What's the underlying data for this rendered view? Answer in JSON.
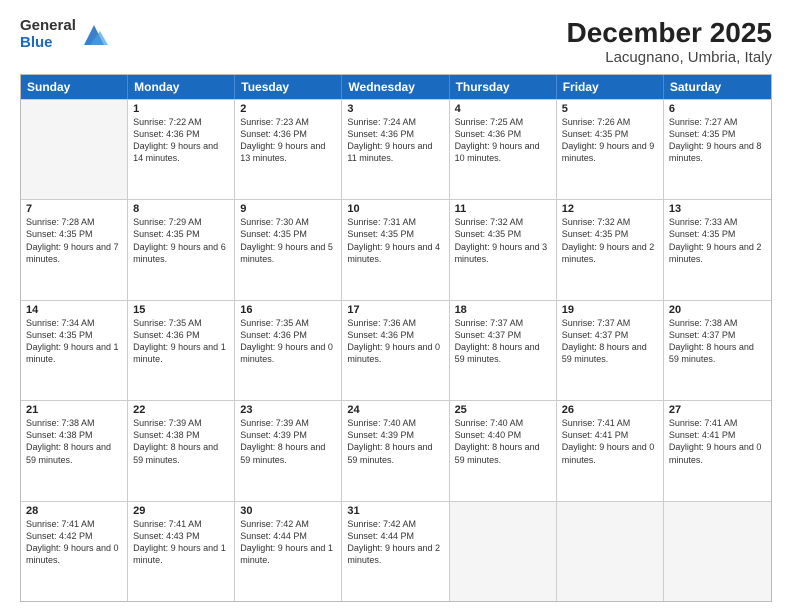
{
  "logo": {
    "general": "General",
    "blue": "Blue"
  },
  "header": {
    "month": "December 2025",
    "location": "Lacugnano, Umbria, Italy"
  },
  "weekdays": [
    "Sunday",
    "Monday",
    "Tuesday",
    "Wednesday",
    "Thursday",
    "Friday",
    "Saturday"
  ],
  "rows": [
    [
      {
        "day": "",
        "sunrise": "",
        "sunset": "",
        "daylight": "",
        "empty": true
      },
      {
        "day": "1",
        "sunrise": "Sunrise: 7:22 AM",
        "sunset": "Sunset: 4:36 PM",
        "daylight": "Daylight: 9 hours and 14 minutes."
      },
      {
        "day": "2",
        "sunrise": "Sunrise: 7:23 AM",
        "sunset": "Sunset: 4:36 PM",
        "daylight": "Daylight: 9 hours and 13 minutes."
      },
      {
        "day": "3",
        "sunrise": "Sunrise: 7:24 AM",
        "sunset": "Sunset: 4:36 PM",
        "daylight": "Daylight: 9 hours and 11 minutes."
      },
      {
        "day": "4",
        "sunrise": "Sunrise: 7:25 AM",
        "sunset": "Sunset: 4:36 PM",
        "daylight": "Daylight: 9 hours and 10 minutes."
      },
      {
        "day": "5",
        "sunrise": "Sunrise: 7:26 AM",
        "sunset": "Sunset: 4:35 PM",
        "daylight": "Daylight: 9 hours and 9 minutes."
      },
      {
        "day": "6",
        "sunrise": "Sunrise: 7:27 AM",
        "sunset": "Sunset: 4:35 PM",
        "daylight": "Daylight: 9 hours and 8 minutes."
      }
    ],
    [
      {
        "day": "7",
        "sunrise": "Sunrise: 7:28 AM",
        "sunset": "Sunset: 4:35 PM",
        "daylight": "Daylight: 9 hours and 7 minutes."
      },
      {
        "day": "8",
        "sunrise": "Sunrise: 7:29 AM",
        "sunset": "Sunset: 4:35 PM",
        "daylight": "Daylight: 9 hours and 6 minutes."
      },
      {
        "day": "9",
        "sunrise": "Sunrise: 7:30 AM",
        "sunset": "Sunset: 4:35 PM",
        "daylight": "Daylight: 9 hours and 5 minutes."
      },
      {
        "day": "10",
        "sunrise": "Sunrise: 7:31 AM",
        "sunset": "Sunset: 4:35 PM",
        "daylight": "Daylight: 9 hours and 4 minutes."
      },
      {
        "day": "11",
        "sunrise": "Sunrise: 7:32 AM",
        "sunset": "Sunset: 4:35 PM",
        "daylight": "Daylight: 9 hours and 3 minutes."
      },
      {
        "day": "12",
        "sunrise": "Sunrise: 7:32 AM",
        "sunset": "Sunset: 4:35 PM",
        "daylight": "Daylight: 9 hours and 2 minutes."
      },
      {
        "day": "13",
        "sunrise": "Sunrise: 7:33 AM",
        "sunset": "Sunset: 4:35 PM",
        "daylight": "Daylight: 9 hours and 2 minutes."
      }
    ],
    [
      {
        "day": "14",
        "sunrise": "Sunrise: 7:34 AM",
        "sunset": "Sunset: 4:35 PM",
        "daylight": "Daylight: 9 hours and 1 minute."
      },
      {
        "day": "15",
        "sunrise": "Sunrise: 7:35 AM",
        "sunset": "Sunset: 4:36 PM",
        "daylight": "Daylight: 9 hours and 1 minute."
      },
      {
        "day": "16",
        "sunrise": "Sunrise: 7:35 AM",
        "sunset": "Sunset: 4:36 PM",
        "daylight": "Daylight: 9 hours and 0 minutes."
      },
      {
        "day": "17",
        "sunrise": "Sunrise: 7:36 AM",
        "sunset": "Sunset: 4:36 PM",
        "daylight": "Daylight: 9 hours and 0 minutes."
      },
      {
        "day": "18",
        "sunrise": "Sunrise: 7:37 AM",
        "sunset": "Sunset: 4:37 PM",
        "daylight": "Daylight: 8 hours and 59 minutes."
      },
      {
        "day": "19",
        "sunrise": "Sunrise: 7:37 AM",
        "sunset": "Sunset: 4:37 PM",
        "daylight": "Daylight: 8 hours and 59 minutes."
      },
      {
        "day": "20",
        "sunrise": "Sunrise: 7:38 AM",
        "sunset": "Sunset: 4:37 PM",
        "daylight": "Daylight: 8 hours and 59 minutes."
      }
    ],
    [
      {
        "day": "21",
        "sunrise": "Sunrise: 7:38 AM",
        "sunset": "Sunset: 4:38 PM",
        "daylight": "Daylight: 8 hours and 59 minutes."
      },
      {
        "day": "22",
        "sunrise": "Sunrise: 7:39 AM",
        "sunset": "Sunset: 4:38 PM",
        "daylight": "Daylight: 8 hours and 59 minutes."
      },
      {
        "day": "23",
        "sunrise": "Sunrise: 7:39 AM",
        "sunset": "Sunset: 4:39 PM",
        "daylight": "Daylight: 8 hours and 59 minutes."
      },
      {
        "day": "24",
        "sunrise": "Sunrise: 7:40 AM",
        "sunset": "Sunset: 4:39 PM",
        "daylight": "Daylight: 8 hours and 59 minutes."
      },
      {
        "day": "25",
        "sunrise": "Sunrise: 7:40 AM",
        "sunset": "Sunset: 4:40 PM",
        "daylight": "Daylight: 8 hours and 59 minutes."
      },
      {
        "day": "26",
        "sunrise": "Sunrise: 7:41 AM",
        "sunset": "Sunset: 4:41 PM",
        "daylight": "Daylight: 9 hours and 0 minutes."
      },
      {
        "day": "27",
        "sunrise": "Sunrise: 7:41 AM",
        "sunset": "Sunset: 4:41 PM",
        "daylight": "Daylight: 9 hours and 0 minutes."
      }
    ],
    [
      {
        "day": "28",
        "sunrise": "Sunrise: 7:41 AM",
        "sunset": "Sunset: 4:42 PM",
        "daylight": "Daylight: 9 hours and 0 minutes."
      },
      {
        "day": "29",
        "sunrise": "Sunrise: 7:41 AM",
        "sunset": "Sunset: 4:43 PM",
        "daylight": "Daylight: 9 hours and 1 minute."
      },
      {
        "day": "30",
        "sunrise": "Sunrise: 7:42 AM",
        "sunset": "Sunset: 4:44 PM",
        "daylight": "Daylight: 9 hours and 1 minute."
      },
      {
        "day": "31",
        "sunrise": "Sunrise: 7:42 AM",
        "sunset": "Sunset: 4:44 PM",
        "daylight": "Daylight: 9 hours and 2 minutes."
      },
      {
        "day": "",
        "sunrise": "",
        "sunset": "",
        "daylight": "",
        "empty": true
      },
      {
        "day": "",
        "sunrise": "",
        "sunset": "",
        "daylight": "",
        "empty": true
      },
      {
        "day": "",
        "sunrise": "",
        "sunset": "",
        "daylight": "",
        "empty": true
      }
    ]
  ]
}
